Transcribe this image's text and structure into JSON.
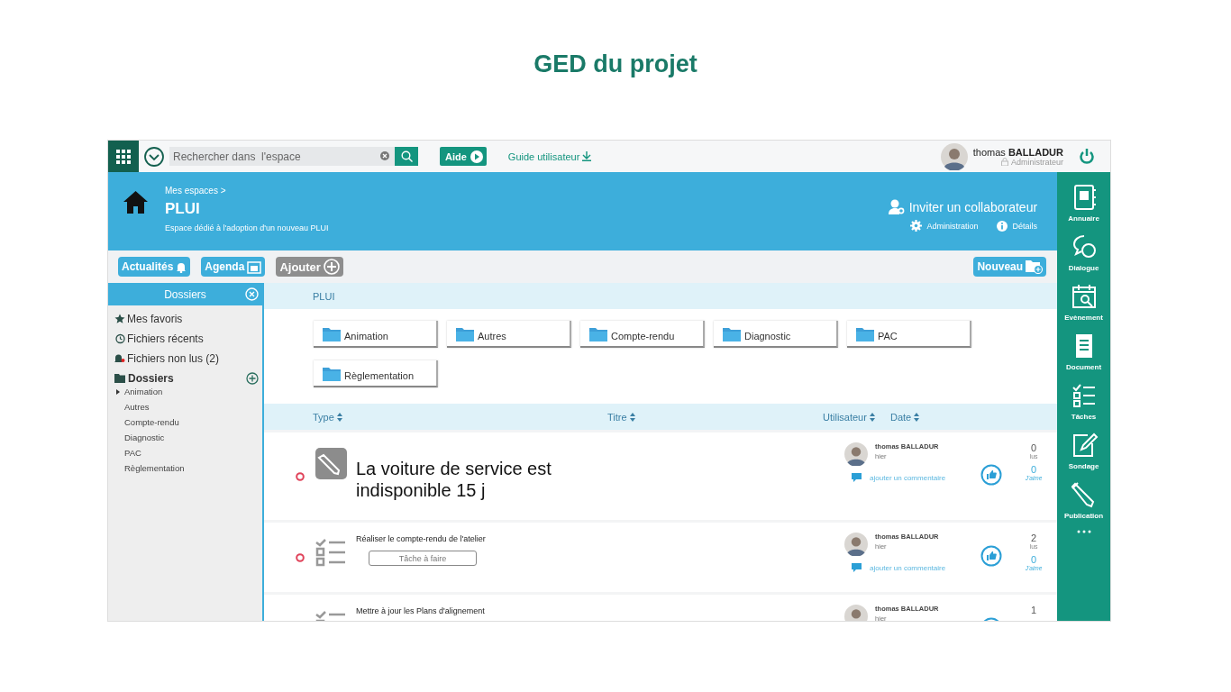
{
  "slide_title": "GED du projet",
  "topbar": {
    "search": {
      "placeholder": "Rechercher dans  l'espace"
    },
    "help_button": "Aide",
    "guide_link": "Guide utilisateur",
    "user": {
      "first_name": "thomas",
      "last_name": "BALLADUR",
      "role": "Administrateur"
    }
  },
  "header": {
    "breadcrumb": "Mes espaces >",
    "title": "PLUI",
    "description": "Espace dédié à l'adoption d'un nouveau PLUI",
    "invite": "Inviter un collaborateur",
    "administration": "Administration",
    "details": "Détails"
  },
  "toolbar": {
    "buttons": [
      {
        "label": "Actualités",
        "kind": "bell"
      },
      {
        "label": "Agenda",
        "kind": "calendar"
      },
      {
        "label": "Ajouter",
        "kind": "add"
      }
    ],
    "new_button": "Nouveau"
  },
  "folders_panel": {
    "title": "Dossiers",
    "links": [
      {
        "label": "Mes favoris",
        "kind": "star"
      },
      {
        "label": "Fichiers récents",
        "kind": "history"
      },
      {
        "label": "Fichiers non lus (2)",
        "kind": "unread"
      }
    ],
    "tree": {
      "label": "Dossiers",
      "children": [
        {
          "label": "Animation",
          "expandable": true
        },
        {
          "label": "Autres",
          "expandable": false
        },
        {
          "label": "Compte-rendu",
          "expandable": false
        },
        {
          "label": "Diagnostic",
          "expandable": false
        },
        {
          "label": "PAC",
          "expandable": false
        },
        {
          "label": "Règlementation",
          "expandable": false
        }
      ]
    }
  },
  "content": {
    "path": "PLUI",
    "folders": [
      "Animation",
      "Autres",
      "Compte-rendu",
      "Diagnostic",
      "PAC",
      "Règlementation"
    ],
    "columns": [
      "Type",
      "Titre",
      "Utilisateur",
      "Date"
    ],
    "items": [
      {
        "kind": "publication",
        "unread": true,
        "title": "La voiture de service est indisponible 15 j",
        "user": "thomas BALLADUR",
        "date": "hier",
        "comment_link": "ajouter un commentaire",
        "reads": "0",
        "reads_label": "lus",
        "likes": "0",
        "likes_label": "J'aime"
      },
      {
        "kind": "task",
        "unread": true,
        "title": "Réaliser le compte-rendu de l'atelier",
        "status": "Tâche à faire",
        "user": "thomas BALLADUR",
        "date": "hier",
        "comment_link": "ajouter un commentaire",
        "reads": "2",
        "reads_label": "lus",
        "likes": "0",
        "likes_label": "J'aime"
      },
      {
        "kind": "task",
        "title": "Mettre à jour les Plans d'alignement",
        "user": "thomas BALLADUR",
        "date": "hier",
        "reads": "1"
      }
    ]
  },
  "side_menu": [
    {
      "label": "Annuaire",
      "kind": "directory"
    },
    {
      "label": "Dialogue",
      "kind": "dialog"
    },
    {
      "label": "Evènement",
      "kind": "event"
    },
    {
      "label": "Document",
      "kind": "document"
    },
    {
      "label": "Tâches",
      "kind": "tasks"
    },
    {
      "label": "Sondage",
      "kind": "survey"
    },
    {
      "label": "Publication",
      "kind": "publication"
    }
  ]
}
